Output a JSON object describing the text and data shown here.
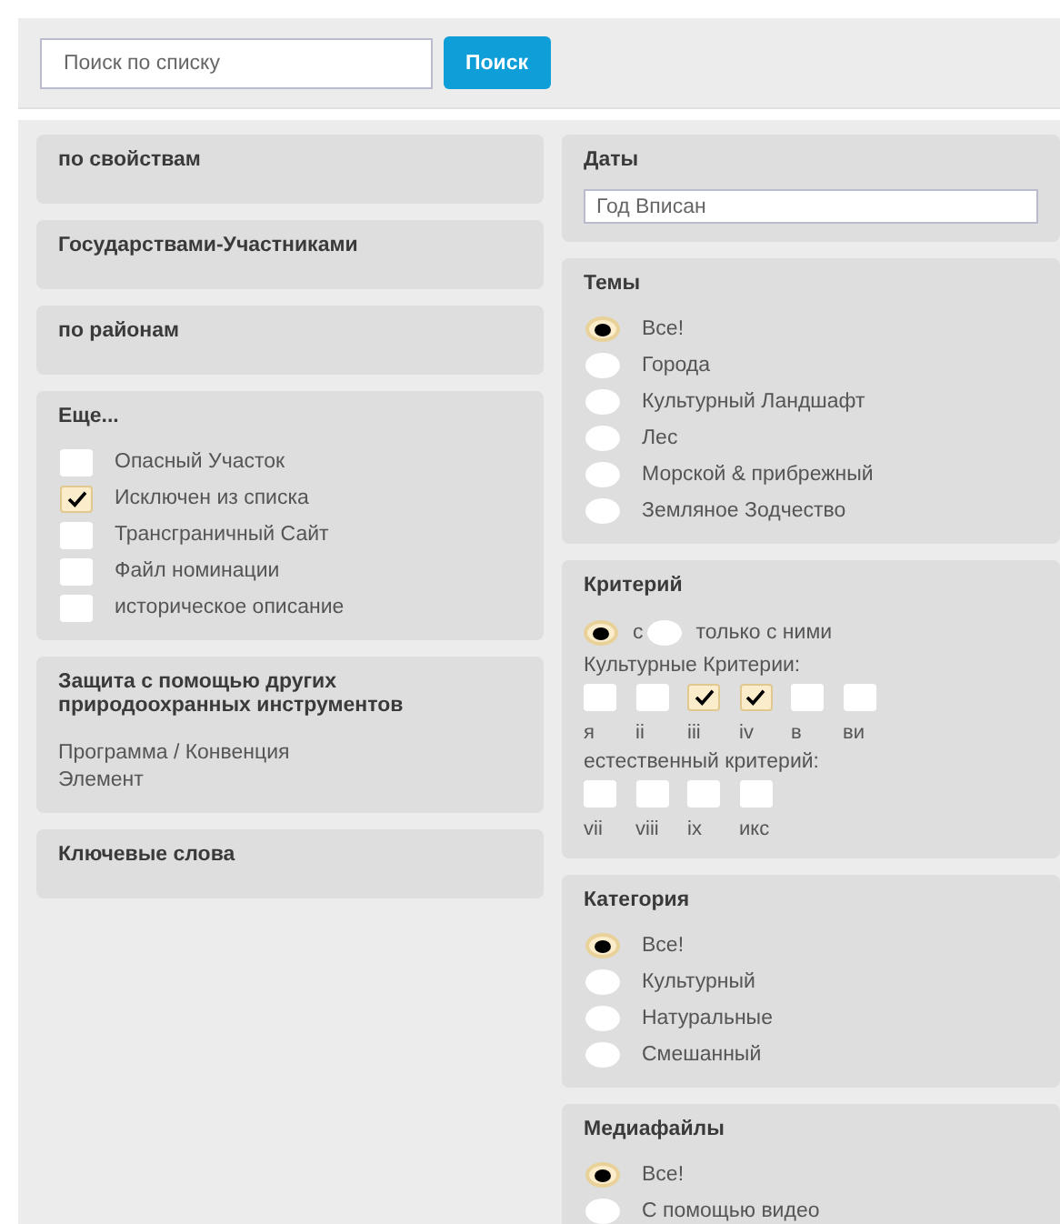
{
  "search": {
    "placeholder": "Поиск по списку",
    "button": "Поиск"
  },
  "left_panels": [
    {
      "kind": "plain",
      "title": "по свойствам"
    },
    {
      "kind": "plain",
      "title": "Государствами-Участниками"
    },
    {
      "kind": "plain",
      "title": "по районам"
    },
    {
      "kind": "checklist",
      "title": "Еще...",
      "items": [
        {
          "label": "Опасный Участок",
          "checked": false
        },
        {
          "label": "Исключен из списка",
          "checked": true
        },
        {
          "label": "Трансграничный Сайт",
          "checked": false
        },
        {
          "label": "Файл номинации",
          "checked": false
        },
        {
          "label": "историческое описание",
          "checked": false
        }
      ]
    },
    {
      "kind": "text",
      "title": "Защита с помощью других природоохранных инструментов",
      "text": "Программа / Конвенция Элемент"
    },
    {
      "kind": "plain",
      "title": "Ключевые слова"
    }
  ],
  "right_panels": [
    {
      "kind": "field",
      "title": "Даты",
      "placeholder": "Год Вписан"
    },
    {
      "kind": "radios",
      "title": "Темы",
      "options": [
        {
          "label": "Все!",
          "selected": true
        },
        {
          "label": "Города",
          "selected": false
        },
        {
          "label": "Культурный Ландшафт",
          "selected": false
        },
        {
          "label": "Лес",
          "selected": false
        },
        {
          "label": "Морской & прибрежный",
          "selected": false
        },
        {
          "label": "Земляное Зодчество",
          "selected": false
        }
      ]
    },
    {
      "kind": "criteria",
      "title": "Критерий",
      "modes": [
        {
          "label": "с",
          "selected": true
        },
        {
          "label": "только с ними",
          "selected": false
        }
      ],
      "groups": [
        {
          "title": "Культурные Критерии:",
          "items": [
            {
              "label": "я",
              "checked": false
            },
            {
              "label": "ii",
              "checked": false
            },
            {
              "label": "iii",
              "checked": true
            },
            {
              "label": "iv",
              "checked": true
            },
            {
              "label": "в",
              "checked": false
            },
            {
              "label": "ви",
              "checked": false
            }
          ]
        },
        {
          "title": "естественный критерий:",
          "items": [
            {
              "label": "vii",
              "checked": false
            },
            {
              "label": "viii",
              "checked": false
            },
            {
              "label": "ix",
              "checked": false
            },
            {
              "label": "икс",
              "checked": false
            }
          ]
        }
      ]
    },
    {
      "kind": "radios",
      "title": "Категория",
      "options": [
        {
          "label": "Все!",
          "selected": true
        },
        {
          "label": "Культурный",
          "selected": false
        },
        {
          "label": "Натуральные",
          "selected": false
        },
        {
          "label": "Смешанный",
          "selected": false
        }
      ]
    },
    {
      "kind": "radios",
      "title": "Медиафайлы",
      "options": [
        {
          "label": "Все!",
          "selected": true
        },
        {
          "label": "С помощью видео",
          "selected": false
        }
      ]
    }
  ]
}
